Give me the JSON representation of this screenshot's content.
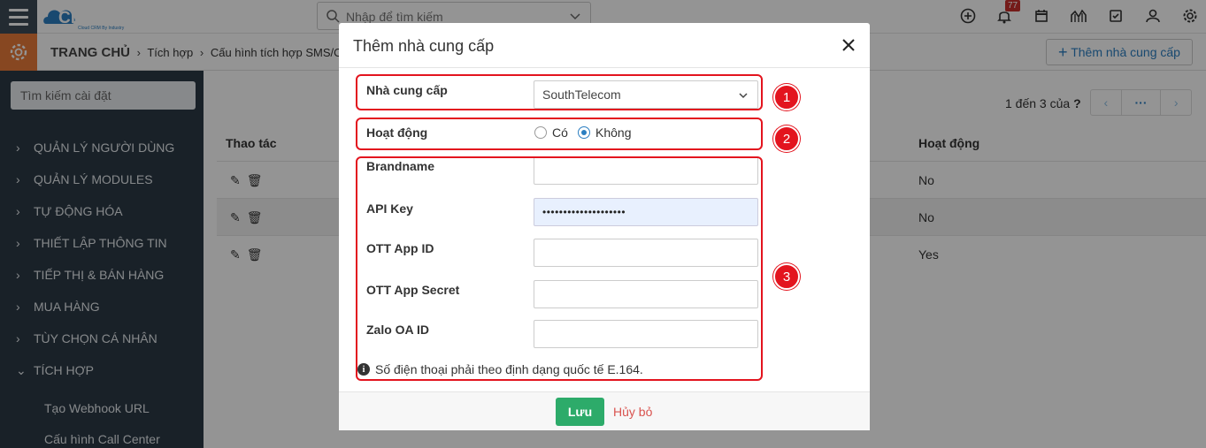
{
  "app": {
    "logo_text": "CLOUDPRO",
    "logo_tagline": "Cloud CRM By Industry"
  },
  "topbar": {
    "search_placeholder": "Nhập để tìm kiếm",
    "notification_count": "77"
  },
  "breadcrumb": {
    "home": "TRANG CHỦ",
    "items": [
      "Tích hợp",
      "Cấu hình tích hợp SMS/OTT"
    ]
  },
  "header": {
    "add_button": "Thêm nhà cung cấp"
  },
  "sidebar": {
    "search_placeholder": "Tìm kiếm cài đặt",
    "items": [
      "QUẢN LÝ NGƯỜI DÙNG",
      "QUẢN LÝ MODULES",
      "TỰ ĐỘNG HÓA",
      "THIẾT LẬP THÔNG TIN",
      "TIẾP THỊ & BÁN HÀNG",
      "MUA HÀNG",
      "TÙY CHỌN CÁ NHÂN",
      "TÍCH HỢP"
    ],
    "subitems": [
      "Tạo Webhook URL",
      "Cấu hình Call Center"
    ]
  },
  "table": {
    "pager_text": "1 đến 3 của",
    "pager_more": "···",
    "columns": [
      "Thao tác",
      "Hoạt động"
    ],
    "rows": [
      {
        "active": "No"
      },
      {
        "active": "No"
      },
      {
        "active": "Yes"
      }
    ]
  },
  "modal": {
    "title": "Thêm nhà cung cấp",
    "provider_label": "Nhà cung cấp",
    "provider_value": "SouthTelecom",
    "active_label": "Hoạt động",
    "active_options": [
      "Có",
      "Không"
    ],
    "active_selected": "Không",
    "fields": [
      {
        "label": "Brandname",
        "value": ""
      },
      {
        "label": "API Key",
        "value": "••••••••••••••••••••"
      },
      {
        "label": "OTT App ID",
        "value": ""
      },
      {
        "label": "OTT App Secret",
        "value": ""
      },
      {
        "label": "Zalo OA ID",
        "value": ""
      }
    ],
    "hint": "Số điện thoại phải theo định dạng quốc tế E.164.",
    "save_label": "Lưu",
    "cancel_label": "Hủy bỏ"
  },
  "annotations": [
    "1",
    "2",
    "3"
  ],
  "colors": {
    "accent": "#2b7ec1",
    "save": "#2dab6a",
    "sidebar": "#2c3a46",
    "highlight": "#e3141e"
  }
}
